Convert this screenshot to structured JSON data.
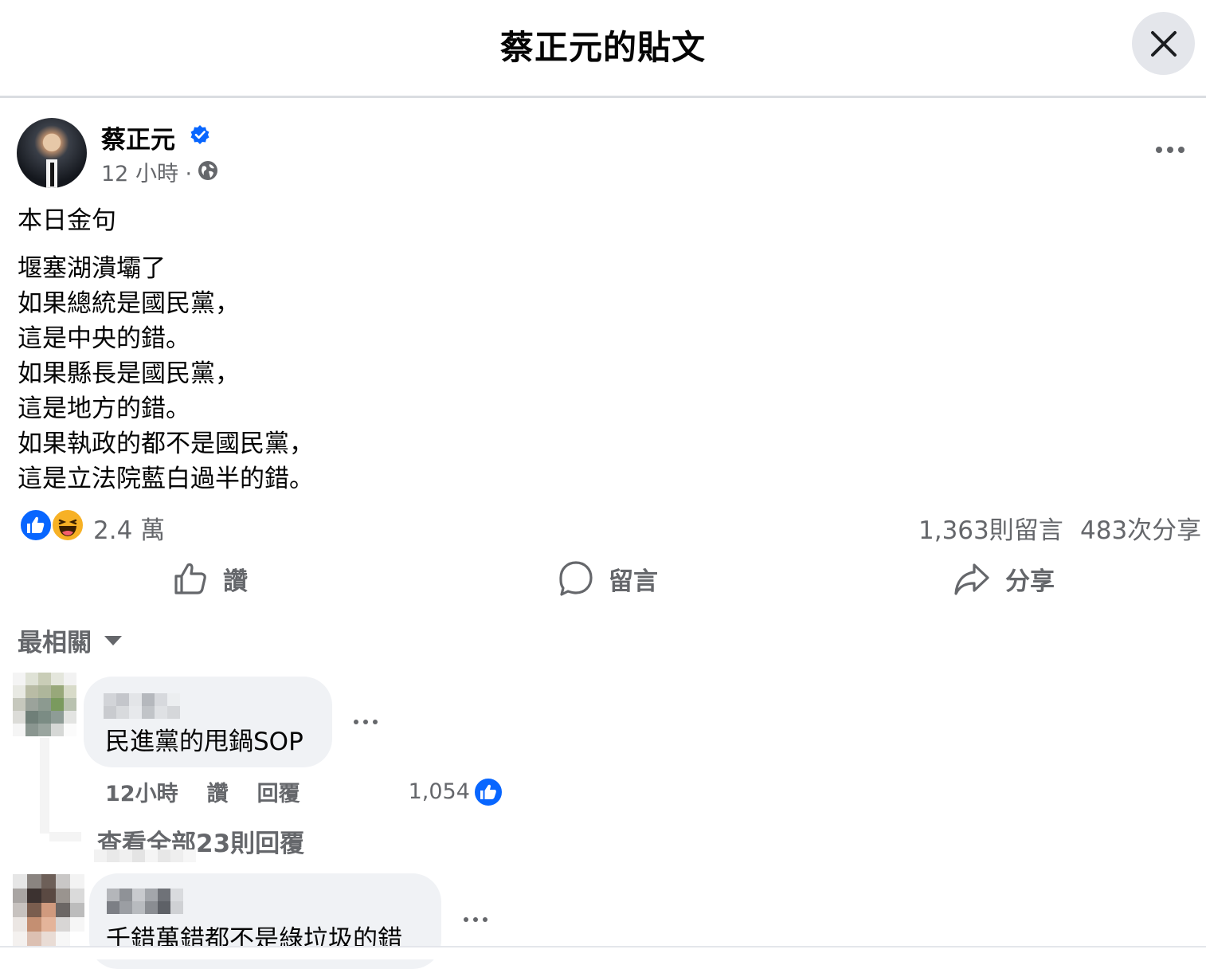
{
  "header": {
    "title": "蔡正元的貼文"
  },
  "post": {
    "author": "蔡正元",
    "verified": true,
    "time": "12 小時 ·",
    "audience_icon": "globe-icon",
    "body": {
      "intro": "本日金句",
      "lines": [
        "堰塞湖潰壩了",
        "如果總統是國民黨，",
        "這是中央的錯。",
        "如果縣長是國民黨，",
        "這是地方的錯。",
        "如果執政的都不是國民黨，",
        "這是立法院藍白過半的錯。"
      ]
    }
  },
  "stats": {
    "reactions": "2.4 萬",
    "reaction_icons": [
      "like-icon",
      "haha-icon"
    ],
    "comments": "1,363則留言",
    "shares": "483次分享"
  },
  "actions": {
    "like": "讚",
    "comment": "留言",
    "share": "分享"
  },
  "filter": {
    "label": "最相關"
  },
  "comments": [
    {
      "text": "民進黨的甩鍋SOP",
      "time": "12小時",
      "like_label": "讚",
      "reply_label": "回覆",
      "like_count": "1,054",
      "view_replies": "查看全部23則回覆"
    },
    {
      "text": "千錯萬錯都不是綠垃圾的錯"
    }
  ],
  "colors": {
    "accent": "#0866ff",
    "secondary_text": "#65676b",
    "bubble": "#f0f2f5",
    "haha": "#f7b125"
  }
}
